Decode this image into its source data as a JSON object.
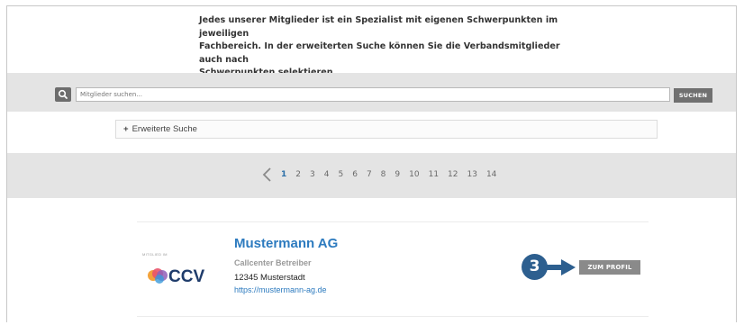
{
  "intro": {
    "line1": "Jedes unserer Mitglieder ist ein Spezialist mit eigenen Schwerpunkten im jeweiligen",
    "line2": "Fachbereich. In der erweiterten Suche können Sie die Verbandsmitglieder auch nach",
    "line3": "Schwerpunkten selektieren."
  },
  "search": {
    "placeholder": "Mitglieder suchen...",
    "button_label": "SUCHEN",
    "icon": "search-icon"
  },
  "advanced_search": {
    "plus": "+",
    "label": "Erweiterte Suche"
  },
  "pagination": {
    "prev_icon": "chevron-left-icon",
    "pages": [
      "1",
      "2",
      "3",
      "4",
      "5",
      "6",
      "7",
      "8",
      "9",
      "10",
      "11",
      "12",
      "13",
      "14"
    ],
    "active_page": "1"
  },
  "member": {
    "logo_caption": "MITGLIED IM",
    "logo_text": "CCV",
    "company": "Mustermann AG",
    "category": "Callcenter Betreiber",
    "address": "12345 Musterstadt",
    "website": "https://mustermann-ag.de",
    "profile_button": "ZUM PROFIL"
  },
  "annotation": {
    "step_number": "3"
  },
  "colors": {
    "accent_blue": "#2d7bbf",
    "badge_blue": "#2d5f8f",
    "band_gray": "#e4e4e4",
    "button_gray": "#8a8a8a"
  }
}
